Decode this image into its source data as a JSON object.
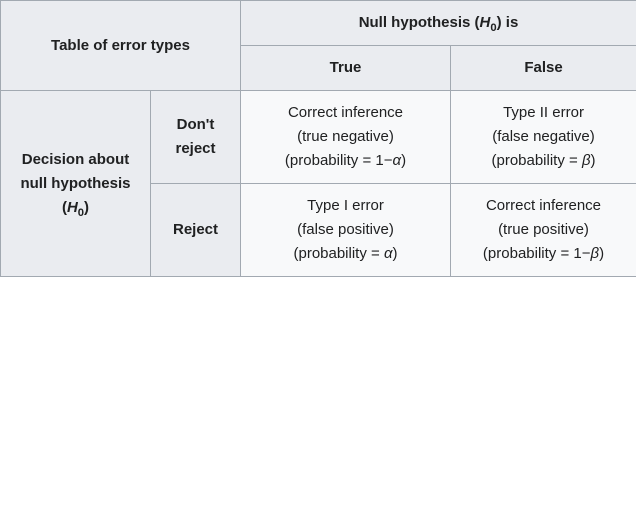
{
  "header": {
    "title": "Table of error types",
    "null_hypothesis_prefix": "Null hypothesis (",
    "null_hypothesis_symbol": "H",
    "null_hypothesis_sub": "0",
    "null_hypothesis_suffix": ") is",
    "col_true": "True",
    "col_false": "False"
  },
  "row_header": {
    "decision_prefix": "Decision about null hypothesis (",
    "decision_symbol": "H",
    "decision_sub": "0",
    "decision_suffix": ")",
    "dont_reject": "Don't reject",
    "reject": "Reject"
  },
  "cells": {
    "dont_reject_true": {
      "line1": "Correct inference",
      "line2": "(true negative)",
      "line3_prefix": "(probability = 1−",
      "line3_symbol": "α",
      "line3_suffix": ")"
    },
    "dont_reject_false": {
      "line1": "Type II error",
      "line2": "(false negative)",
      "line3_prefix": "(probability = ",
      "line3_symbol": "β",
      "line3_suffix": ")"
    },
    "reject_true": {
      "line1": "Type I error",
      "line2": "(false positive)",
      "line3_prefix": "(probability = ",
      "line3_symbol": "α",
      "line3_suffix": ")"
    },
    "reject_false": {
      "line1": "Correct inference",
      "line2": "(true positive)",
      "line3_prefix": "(probability = 1−",
      "line3_symbol": "β",
      "line3_suffix": ")"
    }
  }
}
